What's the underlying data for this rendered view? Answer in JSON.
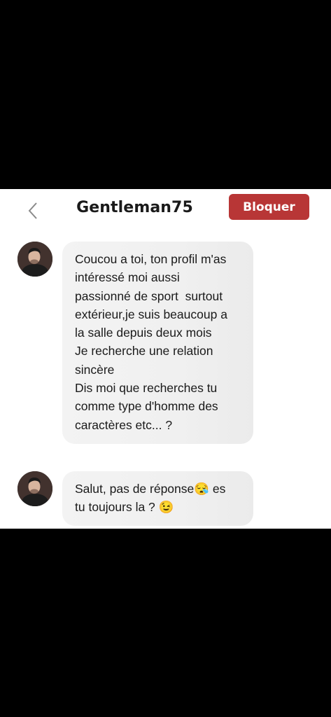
{
  "header": {
    "title": "Gentleman75",
    "block_label": "Bloquer"
  },
  "colors": {
    "block_button": "#b83636",
    "bubble": "#f0f0f0"
  },
  "messages": [
    {
      "sender": "Gentleman75",
      "lines": [
        "Coucou a toi, ton profil m'as",
        "intéressé moi aussi",
        "passionné de sport  surtout",
        "extérieur,je suis beaucoup a",
        "la salle depuis deux mois",
        "Je recherche une relation",
        "sincère",
        "Dis moi que recherches tu",
        "comme type d'homme des",
        "caractères etc... ?"
      ]
    },
    {
      "sender": "Gentleman75",
      "lines": [
        "Salut, pas de réponse😪 es",
        "tu toujours la ? 😉"
      ]
    }
  ]
}
